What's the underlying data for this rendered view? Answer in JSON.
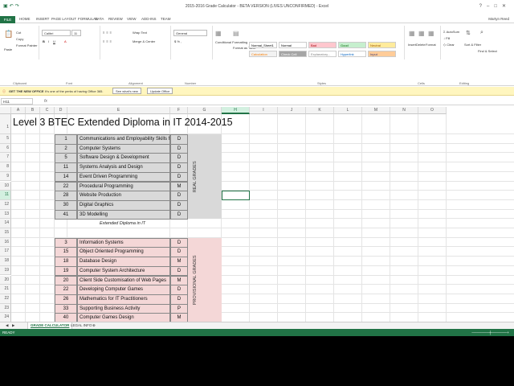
{
  "window": {
    "title": "2015-2016 Grade Calculator - BETA VERSION (LIVES UNCONFIRMED) - Excel",
    "user": "Martyn Reed",
    "qat_icons": [
      "save-icon",
      "undo-icon",
      "redo-icon"
    ]
  },
  "ribbon_tabs": [
    "FILE",
    "HOME",
    "INSERT",
    "PAGE LAYOUT",
    "FORMULAS",
    "DATA",
    "REVIEW",
    "VIEW",
    "ADD-INS",
    "TEAM"
  ],
  "ribbon": {
    "clipboard": {
      "cut": "Cut",
      "copy": "Copy",
      "format_painter": "Format Painter",
      "paste": "Paste",
      "label": "Clipboard"
    },
    "font": {
      "name": "Calibri",
      "size": "11",
      "label": "Font"
    },
    "alignment": {
      "wrap": "Wrap Text",
      "merge": "Merge & Center",
      "label": "Alignment"
    },
    "number": {
      "format": "General",
      "label": "Number"
    },
    "styles": {
      "conditional": "Conditional Formatting",
      "format_table": "Format as Table",
      "cells": [
        {
          "label": "Normal_Sheet1",
          "bg": "#ffffff",
          "fg": "#000000"
        },
        {
          "label": "Normal",
          "bg": "#ffffff",
          "fg": "#000000"
        },
        {
          "label": "Bad",
          "bg": "#ffc7ce",
          "fg": "#9c0006"
        },
        {
          "label": "Good",
          "bg": "#c6efce",
          "fg": "#006100"
        },
        {
          "label": "Neutral",
          "bg": "#ffeb9c",
          "fg": "#9c5700"
        },
        {
          "label": "Calculation",
          "bg": "#f2f2f2",
          "fg": "#fa7d00"
        },
        {
          "label": "Check Cell",
          "bg": "#a5a5a5",
          "fg": "#ffffff"
        },
        {
          "label": "Explanatory...",
          "bg": "#ffffff",
          "fg": "#7f7f7f"
        },
        {
          "label": "Hyperlink",
          "bg": "#ffffff",
          "fg": "#0563c1"
        },
        {
          "label": "Input",
          "bg": "#ffcc99",
          "fg": "#3f3f76"
        }
      ],
      "label": "Styles"
    },
    "cells_group": {
      "insert": "Insert",
      "delete": "Delete",
      "format": "Format",
      "label": "Cells"
    },
    "editing": {
      "autosum": "AutoSum",
      "fill": "Fill",
      "clear": "Clear",
      "sort": "Sort & Filter",
      "find": "Find & Select",
      "label": "Editing"
    }
  },
  "message_bar": {
    "label": "GET THE NEW OFFICE",
    "text": "It's one of the perks of having Office 365.",
    "btn1": "See what's new",
    "btn2": "Update Office"
  },
  "formula_bar": {
    "name_box": "H11",
    "fx": "fx",
    "value": ""
  },
  "columns": [
    "A",
    "B",
    "C",
    "D",
    "E",
    "F",
    "G",
    "H",
    "I",
    "J",
    "K",
    "L",
    "M",
    "N",
    "O"
  ],
  "selected_column": "H",
  "selected_row": 11,
  "rows": [
    "1",
    "5",
    "6",
    "7",
    "8",
    "9",
    "10",
    "11",
    "12",
    "13",
    "14",
    "15",
    "16",
    "17",
    "18",
    "19",
    "20",
    "21",
    "22",
    "23",
    "24",
    "25"
  ],
  "sheet_title": "Level 3 BTEC Extended Diploma in IT 2014-2015",
  "real_grades_label": "REAL GRADES",
  "provisional_label": "PROVISIONAL GRADES",
  "section_header": "Extended Diploma in IT",
  "real_units": [
    {
      "num": "1",
      "name": "Communications and Employability Skills for IT",
      "grade": "D"
    },
    {
      "num": "2",
      "name": "Computer Systems",
      "grade": "D"
    },
    {
      "num": "5",
      "name": "Software Design & Development",
      "grade": "D"
    },
    {
      "num": "11",
      "name": "Systems Analysis and Design",
      "grade": "D"
    },
    {
      "num": "14",
      "name": "Event Driven Programming",
      "grade": "D"
    },
    {
      "num": "22",
      "name": "Procedural Programming",
      "grade": "M"
    },
    {
      "num": "28",
      "name": "Website Production",
      "grade": "D"
    },
    {
      "num": "30",
      "name": "Digital Graphics",
      "grade": "D"
    },
    {
      "num": "41",
      "name": "3D Modelling",
      "grade": "D"
    }
  ],
  "provisional_units": [
    {
      "num": "3",
      "name": "Information Systems",
      "grade": "D"
    },
    {
      "num": "15",
      "name": "Object Oriented Programming",
      "grade": "D"
    },
    {
      "num": "18",
      "name": "Database Design",
      "grade": "M"
    },
    {
      "num": "19",
      "name": "Computer System Architecture",
      "grade": "D"
    },
    {
      "num": "20",
      "name": "Client Side Customisation of Web Pages",
      "grade": "M"
    },
    {
      "num": "22",
      "name": "Developing Computer Games",
      "grade": "D"
    },
    {
      "num": "26",
      "name": "Mathematics for IT Practitioners",
      "grade": "D"
    },
    {
      "num": "33",
      "name": "Supporting Business Activity",
      "grade": "P"
    },
    {
      "num": "40",
      "name": "Computer Games Design",
      "grade": "M"
    }
  ],
  "sheet_tabs": [
    "GRADE CALCULATOR",
    "LEGAL INFO"
  ],
  "status": {
    "left": "READY"
  },
  "colors": {
    "accent": "#217346",
    "gray_fill": "#d9d9d9",
    "pink_fill": "#f4d7d7"
  }
}
